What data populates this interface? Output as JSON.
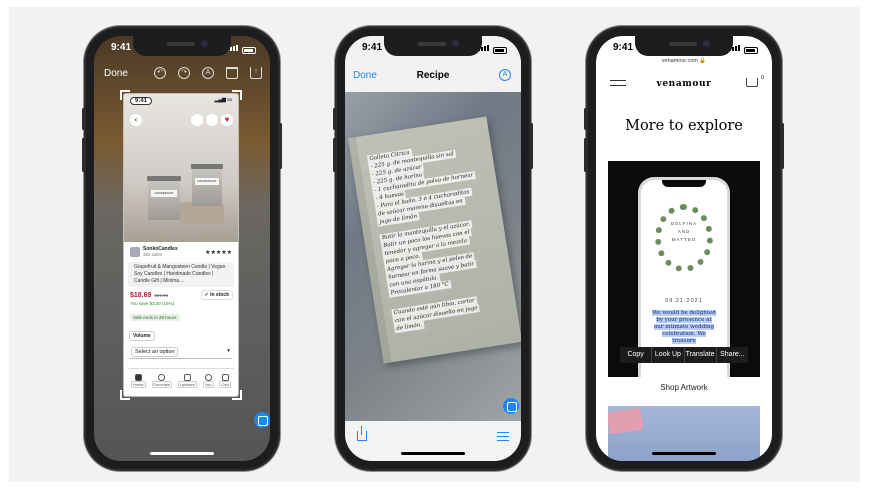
{
  "colors": {
    "accent": "#1e86f0",
    "price": "#b3133a",
    "selection": "#b7cff7",
    "background": "#f2f2f4"
  },
  "phone1": {
    "status_time": "9:41",
    "toolbar": {
      "done_label": "Done",
      "tools": [
        "undo-icon",
        "redo-icon",
        "markup-icon",
        "trash-icon",
        "share-icon"
      ]
    },
    "screenshot": {
      "status_time": "9:41",
      "shop_name": "SonkoCandles",
      "sales": "382 sales",
      "stars": "★★★★★",
      "product_title": "Grapefruit & Mangosteen Candle | Vegan Soy Candles | Handmade Candles | Candle Gift | Minima…",
      "price": "$18.69",
      "original_price": "$21.99",
      "savings": "You save $3.30 (15%)",
      "sale_ends": "Sale ends in 28 hours",
      "in_stock": "✓ In stock",
      "volume_label": "Volume",
      "select_placeholder": "Select an option",
      "select_caret": "▾",
      "back_glyph": "‹",
      "heart_glyph": "♥",
      "carousel_dots": "• • • • •",
      "candle_label_1": "GRAPEFRUIT",
      "candle_label_2": "GRAPEFRUIT",
      "tabs": [
        {
          "label": "Home",
          "icon": "home-icon"
        },
        {
          "label": "Favorites",
          "icon": "heart-icon"
        },
        {
          "label": "Updates",
          "icon": "bell-icon"
        },
        {
          "label": "You",
          "icon": "person-icon"
        },
        {
          "label": "Cart",
          "icon": "cart-icon"
        }
      ]
    }
  },
  "phone2": {
    "status_time": "9:41",
    "done_label": "Done",
    "title": "Recipe",
    "markup_glyph": "A",
    "notes": {
      "block1": [
        "Galleta Cítrica",
        "- 225 g. de mantequilla sin sal",
        "- 225 g. de azúcar",
        "- 225 g. de harina",
        "- 1 cucharadita de polvo de hornear",
        "- 4 huevos",
        "- Para el baño, 3 ó 4 cucharaditas",
        "  de azúcar moreno disueltas en",
        "  jugo de limón"
      ],
      "block2": [
        "Batir la mantequilla y el azúcar.",
        "Batir un poco los huevos con el",
        "tenedor y agregar a la mezcla",
        "poco a poco.",
        "Agregar la harina y el polvo de",
        "hornear en forma suave y batir",
        "con una espátula.",
        "Precalentar a 180 °C"
      ],
      "block3": [
        "Cuando esté aún tibio, cortar",
        "con el azúcar disuelto en jugo",
        "de limón."
      ]
    }
  },
  "phone3": {
    "status_time": "9:41",
    "url": "venamour.com 🔒",
    "logo": "venamour",
    "cart_badge": "0",
    "heading": "More to explore",
    "invite": {
      "name1": "DELFINA",
      "and": "AND",
      "name2": "MATTEO",
      "date": "09.21.2021",
      "selected_text": "We would be delighted by your presence at our intimate wedding celebration. We treasure"
    },
    "context_menu": [
      "Copy",
      "Look Up",
      "Translate",
      "Share..."
    ],
    "shop_link": "Shop Artwork"
  }
}
